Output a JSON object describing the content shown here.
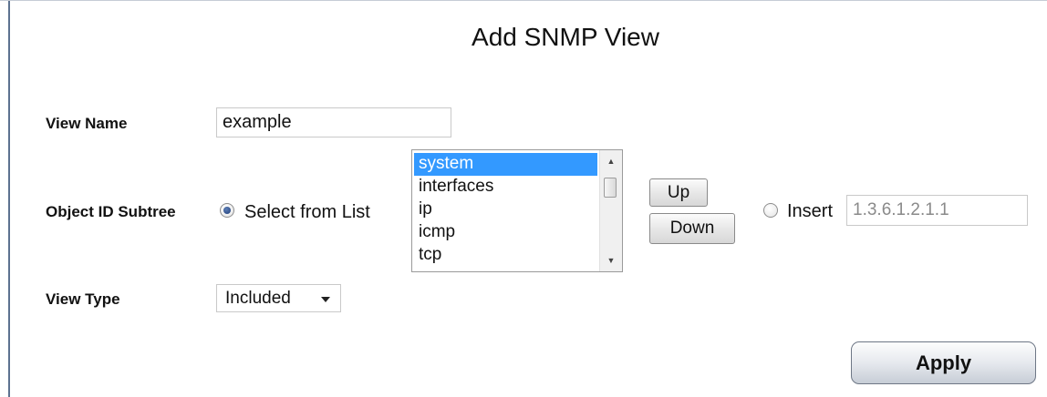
{
  "form": {
    "title": "Add SNMP View",
    "view_name": {
      "label": "View Name",
      "value": "example"
    },
    "object_id_subtree": {
      "label": "Object ID Subtree",
      "select_from_list_label": "Select from List",
      "select_from_list_checked": true,
      "list_items": [
        "system",
        "interfaces",
        "ip",
        "icmp",
        "tcp"
      ],
      "selected_item": "system",
      "up_label": "Up",
      "down_label": "Down",
      "insert_label": "Insert",
      "insert_checked": false,
      "insert_value": "1.3.6.1.2.1.1"
    },
    "view_type": {
      "label": "View Type",
      "selected": "Included"
    },
    "apply_label": "Apply"
  },
  "icons": {
    "scroll_up": "scroll-up-arrow-icon",
    "scroll_down": "scroll-down-arrow-icon",
    "dropdown": "chevron-down-icon"
  },
  "colors": {
    "selection": "#3399ff",
    "left_border": "#5d7290"
  }
}
